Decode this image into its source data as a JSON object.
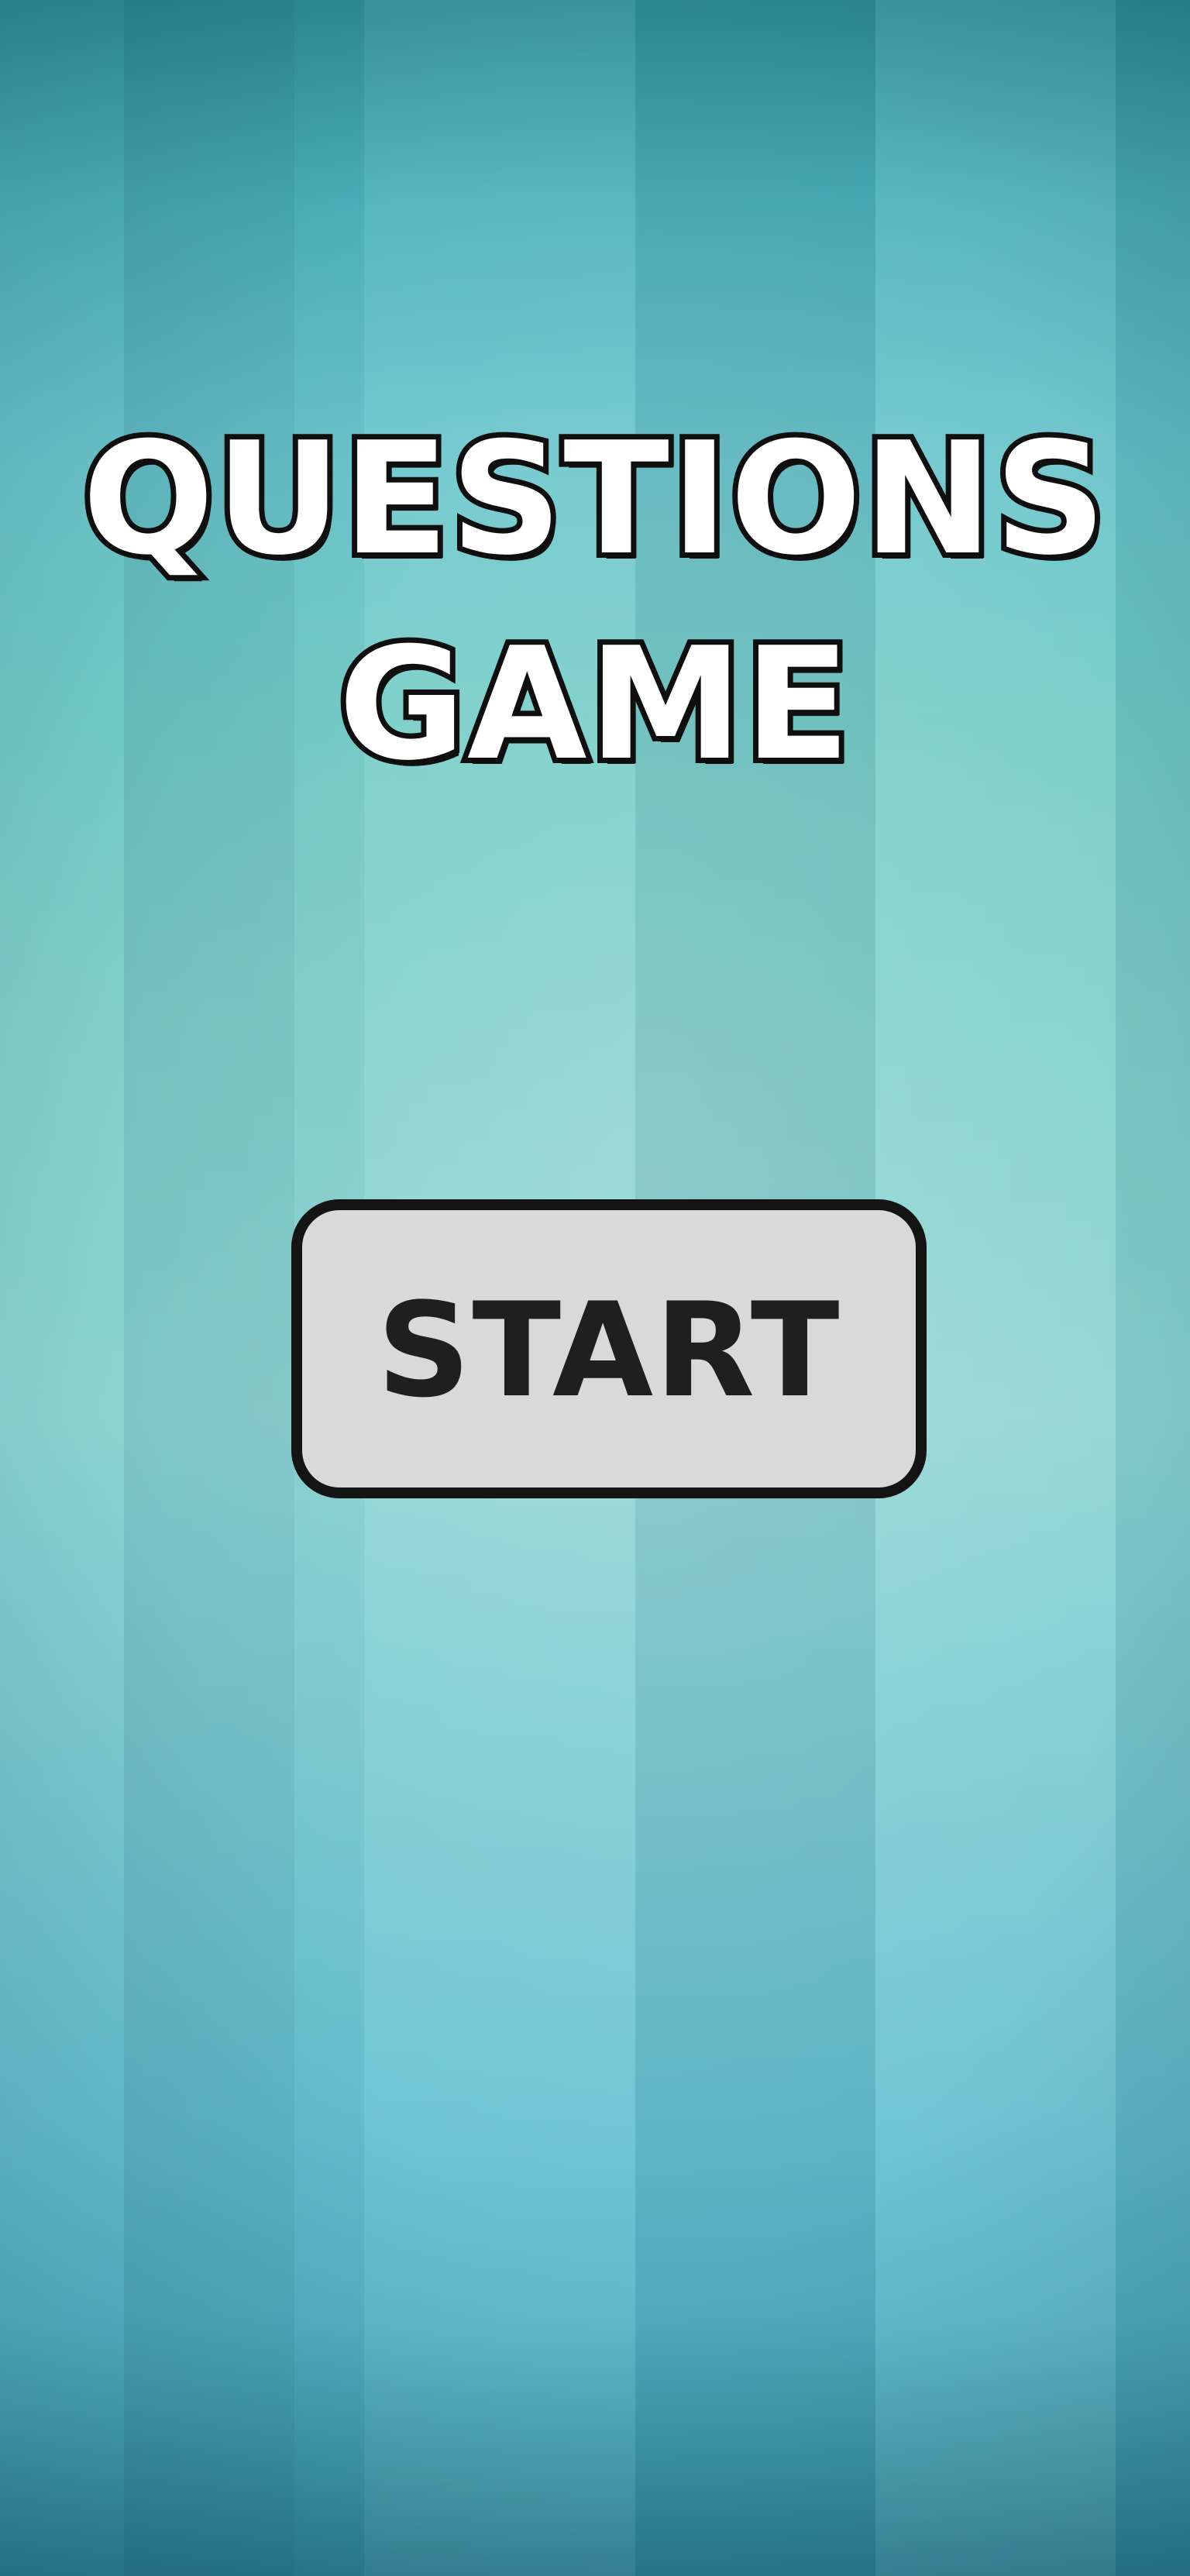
{
  "title": {
    "line1": "QUESTIONS",
    "line2": "GAME"
  },
  "start_button": {
    "label": "START"
  },
  "colors": {
    "background_teal": "#74ccc6",
    "title_fill": "#ffffff",
    "title_outline": "#0f0f0f",
    "button_fill": "#d9d9d9",
    "button_border": "#141414",
    "button_text": "#1f1f1f"
  }
}
